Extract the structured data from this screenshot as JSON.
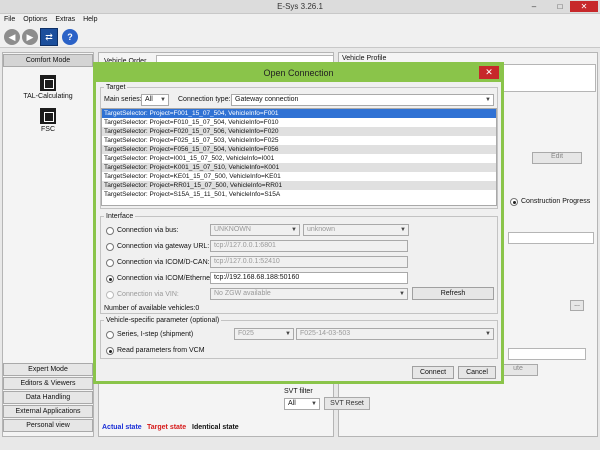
{
  "window": {
    "title": "E-Sys 3.26.1",
    "min": "–",
    "max": "□",
    "close": "✕"
  },
  "menu": [
    "File",
    "Options",
    "Extras",
    "Help"
  ],
  "left": {
    "header": "Comfort Mode",
    "items": [
      {
        "label": "TAL-Calculating"
      },
      {
        "label": "FSC"
      }
    ],
    "bottom": [
      "Expert Mode",
      "Editors & Viewers",
      "Data Handling",
      "External Applications",
      "Personal view"
    ]
  },
  "background": {
    "vehicle_order": "Vehicle Order",
    "vehicle_profile": "Vehicle Profile",
    "edit": "Edit",
    "construction_progress": "Construction Progress",
    "svt_filter": "SVT filter",
    "svt_all": "All",
    "svt_reset": "SVT Reset",
    "ellipsis": "...",
    "calculate": "ute",
    "legend": [
      {
        "label": "Actual state",
        "color": "#1a2fd6"
      },
      {
        "label": "Target state",
        "color": "#d61a1a"
      },
      {
        "label": "Identical state",
        "color": "#111111"
      }
    ]
  },
  "dialog": {
    "title": "Open Connection",
    "close": "✕",
    "target": {
      "legend": "Target",
      "main_series_label": "Main series:",
      "main_series_value": "All",
      "conn_type_label": "Connection type:",
      "conn_type_value": "Gateway connection",
      "rows": [
        "TargetSelector: Project=F001_15_07_504, VehicleInfo=F001",
        "TargetSelector: Project=F010_15_07_504, VehicleInfo=F010",
        "TargetSelector: Project=F020_15_07_506, VehicleInfo=F020",
        "TargetSelector: Project=F025_15_07_503, VehicleInfo=F025",
        "TargetSelector: Project=F056_15_07_504, VehicleInfo=F056",
        "TargetSelector: Project=I001_15_07_502, VehicleInfo=I001",
        "TargetSelector: Project=K001_15_07_510, VehicleInfo=K001",
        "TargetSelector: Project=KE01_15_07_500, VehicleInfo=KE01",
        "TargetSelector: Project=RR01_15_07_500, VehicleInfo=RR01",
        "TargetSelector: Project=S15A_15_11_501, VehicleInfo=S15A"
      ]
    },
    "interface": {
      "legend": "Interface",
      "bus_label": "Connection via bus:",
      "bus_value1": "UNKNOWN",
      "bus_value2": "unknown",
      "gateway_label": "Connection via gateway URL:",
      "gateway_value": "tcp://127.0.0.1:6801",
      "dcan_label": "Connection via ICOM/D-CAN:",
      "dcan_value": "tcp://127.0.0.1:52410",
      "eth_label": "Connection via ICOM/Ethernet:",
      "eth_value": "tcp://192.168.68.188:50160",
      "vin_label": "Connection via VIN:",
      "vin_value": "No ZGW available",
      "refresh": "Refresh",
      "available": "Number of available vehicles:0"
    },
    "vehicle_param": {
      "legend": "Vehicle-specific parameter (optional)",
      "series_label": "Series, I-step (shipment)",
      "series_value": "F025",
      "istep_value": "F025-14-03-503",
      "read_label": "Read parameters from VCM"
    },
    "connect": "Connect",
    "cancel": "Cancel"
  }
}
